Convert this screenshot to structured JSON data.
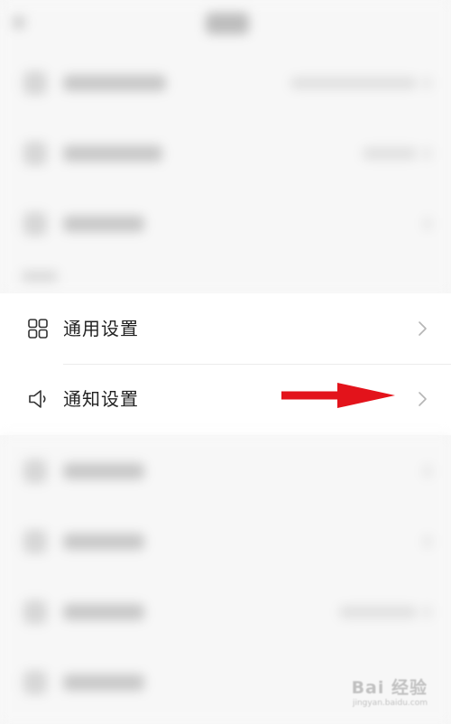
{
  "settings": {
    "items": [
      {
        "label": "通用设置",
        "icon": "grid-icon"
      },
      {
        "label": "通知设置",
        "icon": "speaker-icon"
      }
    ]
  },
  "watermark": {
    "main": "Bai 经验",
    "sub": "jingyan.baidu.com"
  },
  "colors": {
    "page_background": "#f7f7f7",
    "card_background": "#ffffff",
    "label_text": "#222222",
    "annotation_arrow": "#e3131b"
  }
}
